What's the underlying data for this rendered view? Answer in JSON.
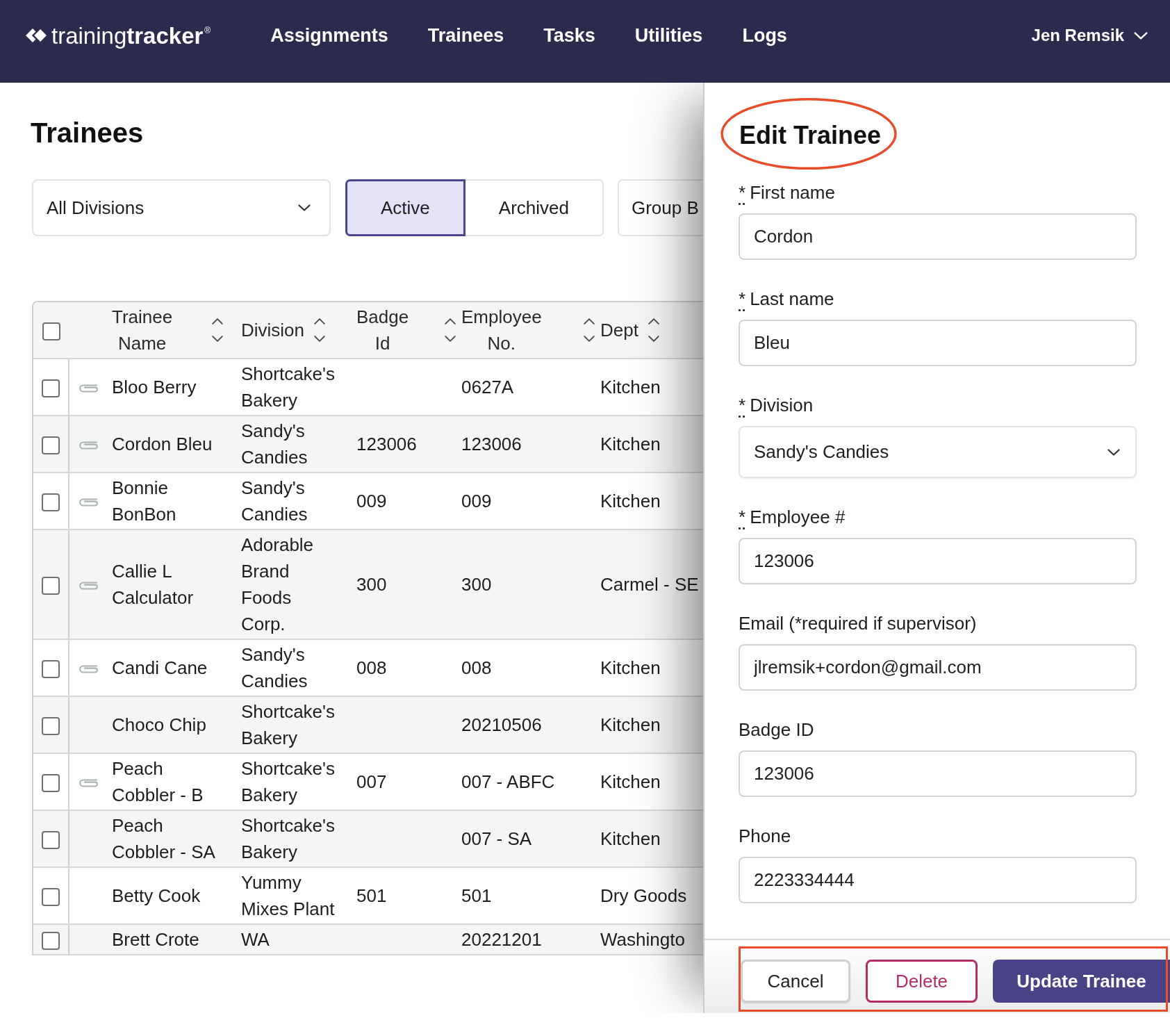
{
  "header": {
    "logo": "training**tracker**$^{®}$",
    "nav": [
      {
        "label": "Assignments"
      },
      {
        "label": "Trainees"
      },
      {
        "label": "Tasks"
      },
      {
        "label": "Utilities"
      },
      {
        "label": "Logs"
      }
    ],
    "user": {
      "name": "Jen Remsik"
    }
  },
  "page": {
    "title": "Trainees",
    "division_filter": {
      "value": "All Divisions"
    },
    "status_toggle": [
      {
        "label": "Active",
        "selected": true
      },
      {
        "label": "Archived",
        "selected": false
      }
    ],
    "group_button": {
      "label": "Group B"
    }
  },
  "table": {
    "select_all": {
      "checked": false
    },
    "columns": [
      {
        "label": "Trainee Name",
        "sortable": true
      },
      {
        "label": "Division",
        "sortable": true
      },
      {
        "label": "Badge Id",
        "sortable": true
      },
      {
        "label": "Employee No.",
        "sortable": true
      },
      {
        "label": "Dept",
        "sortable": true
      }
    ],
    "rows": [
      {
        "checked": false,
        "attachment": true,
        "name": "Bloo Berry",
        "division": "Shortcake's Bakery",
        "employee_no": "0627A",
        "dept": "Kitchen"
      },
      {
        "checked": false,
        "attachment": true,
        "name": "Cordon Bleu",
        "division": "Sandy's Candies",
        "badge_id": "123006",
        "employee_no": "123006",
        "dept": "Kitchen"
      },
      {
        "checked": false,
        "attachment": true,
        "name": "Bonnie BonBon",
        "division": "Sandy's Candies",
        "badge_id": "009",
        "employee_no": "009",
        "dept": "Kitchen"
      },
      {
        "checked": false,
        "attachment": true,
        "name": "Callie L Calculator",
        "division": "Adorable Brand Foods Corp.",
        "badge_id": "300",
        "employee_no": "300",
        "dept": "Carmel - SE"
      },
      {
        "checked": false,
        "attachment": true,
        "name": "Candi Cane",
        "division": "Sandy's Candies",
        "badge_id": "008",
        "employee_no": "008",
        "dept": "Kitchen"
      },
      {
        "checked": false,
        "attachment": false,
        "name": "Choco Chip",
        "division": "Shortcake's Bakery",
        "employee_no": "20210506",
        "dept": "Kitchen"
      },
      {
        "checked": false,
        "attachment": true,
        "name": "Peach Cobbler - B",
        "division": "Shortcake's Bakery",
        "badge_id": "007",
        "employee_no": "007 - ABFC",
        "dept": "Kitchen"
      },
      {
        "checked": false,
        "attachment": false,
        "name": "Peach Cobbler - SA",
        "division": "Shortcake's Bakery",
        "employee_no": "007 - SA",
        "dept": "Kitchen"
      },
      {
        "checked": false,
        "attachment": false,
        "name": "Betty Cook",
        "division": "Yummy Mixes Plant",
        "badge_id": "501",
        "employee_no": "501",
        "dept": "Dry Goods"
      },
      {
        "checked": false,
        "attachment": false,
        "name": "Brett Crote",
        "division": "WA",
        "employee_no": "20221201",
        "dept": "Washingto"
      }
    ]
  },
  "panel": {
    "title": {
      "text": "Edit Trainee",
      "circled": true
    },
    "fields": [
      {
        "kind": "text",
        "required_mark": "*",
        "label": "First name",
        "value": "Cordon"
      },
      {
        "kind": "text",
        "required_mark": "*",
        "label": "Last name",
        "value": "Bleu"
      },
      {
        "kind": "select",
        "required_mark": "*",
        "label": "Division",
        "value": "Sandy's Candies"
      },
      {
        "kind": "text",
        "required_mark": "*",
        "label": "Employee #",
        "value": "123006"
      },
      {
        "kind": "text",
        "label": "Email (*required if supervisor)",
        "value": "jlremsik+cordon@gmail.com"
      },
      {
        "kind": "text",
        "label": "Badge ID",
        "value": "123006"
      },
      {
        "kind": "text",
        "label": "Phone",
        "value": "2223334444"
      }
    ],
    "footer": {
      "boxed": true,
      "buttons": [
        {
          "kind": "cancel",
          "label": "Cancel"
        },
        {
          "kind": "delete",
          "label": "Delete"
        },
        {
          "kind": "primary",
          "label": "Update Trainee"
        }
      ]
    }
  }
}
